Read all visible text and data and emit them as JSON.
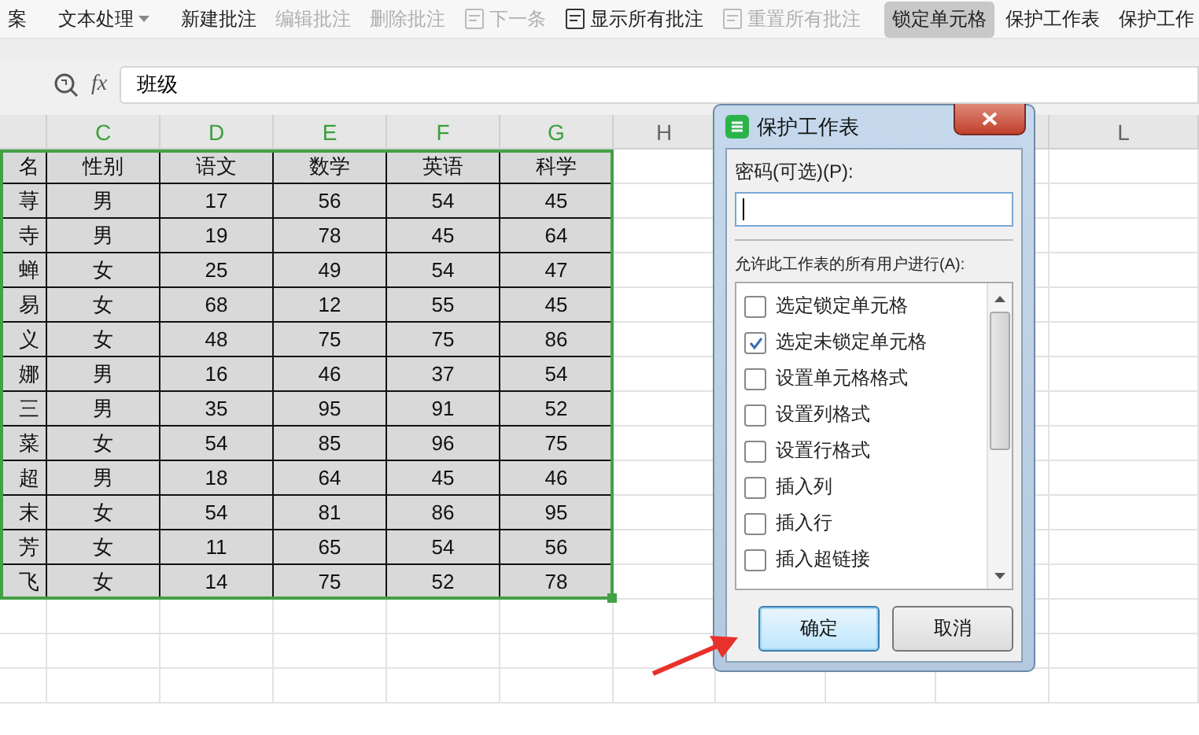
{
  "ribbon": {
    "items": [
      {
        "label": "案",
        "kind": "plain",
        "disabled": false,
        "selected": false
      },
      {
        "label": "文本处理",
        "kind": "dropdown",
        "disabled": false,
        "selected": false
      },
      {
        "label": "新建批注",
        "kind": "plain",
        "disabled": false,
        "selected": false
      },
      {
        "label": "编辑批注",
        "kind": "plain",
        "disabled": true,
        "selected": false
      },
      {
        "label": "删除批注",
        "kind": "plain",
        "disabled": true,
        "selected": false
      },
      {
        "label": "下一条",
        "kind": "icon",
        "disabled": true,
        "selected": false
      },
      {
        "label": "显示所有批注",
        "kind": "icon",
        "disabled": false,
        "selected": false
      },
      {
        "label": "重置所有批注",
        "kind": "icon",
        "disabled": true,
        "selected": false
      },
      {
        "label": "锁定单元格",
        "kind": "plain",
        "disabled": false,
        "selected": true
      },
      {
        "label": "保护工作表",
        "kind": "plain",
        "disabled": false,
        "selected": false
      },
      {
        "label": "保护工作",
        "kind": "plain",
        "disabled": false,
        "selected": false
      }
    ]
  },
  "formula_bar": {
    "fx": "fx",
    "value": "班级"
  },
  "sheet": {
    "column_headers": [
      "C",
      "D",
      "E",
      "F",
      "G",
      "H"
    ],
    "right_column_headers": [
      "L"
    ],
    "rows": [
      [
        "名",
        "性别",
        "语文",
        "数学",
        "英语",
        "科学"
      ],
      [
        "荨",
        "男",
        "17",
        "56",
        "54",
        "45"
      ],
      [
        "寺",
        "男",
        "19",
        "78",
        "45",
        "64"
      ],
      [
        "蝉",
        "女",
        "25",
        "49",
        "54",
        "47"
      ],
      [
        "易",
        "女",
        "68",
        "12",
        "55",
        "45"
      ],
      [
        "义",
        "女",
        "48",
        "75",
        "75",
        "86"
      ],
      [
        "娜",
        "男",
        "16",
        "46",
        "37",
        "54"
      ],
      [
        "三",
        "男",
        "35",
        "95",
        "91",
        "52"
      ],
      [
        "菜",
        "女",
        "54",
        "85",
        "96",
        "75"
      ],
      [
        "超",
        "男",
        "18",
        "64",
        "45",
        "46"
      ],
      [
        "末",
        "女",
        "54",
        "81",
        "86",
        "95"
      ],
      [
        "芳",
        "女",
        "11",
        "65",
        "54",
        "56"
      ],
      [
        "飞",
        "女",
        "14",
        "75",
        "52",
        "78"
      ]
    ]
  },
  "dialog": {
    "title": "保护工作表",
    "password_label": "密码(可选)(P):",
    "password_focused": true,
    "permissions_label": "允许此工作表的所有用户进行(A):",
    "permissions": [
      {
        "label": "选定锁定单元格",
        "checked": false
      },
      {
        "label": "选定未锁定单元格",
        "checked": true
      },
      {
        "label": "设置单元格格式",
        "checked": false
      },
      {
        "label": "设置列格式",
        "checked": false
      },
      {
        "label": "设置行格式",
        "checked": false
      },
      {
        "label": "插入列",
        "checked": false
      },
      {
        "label": "插入行",
        "checked": false
      },
      {
        "label": "插入超链接",
        "checked": false
      }
    ],
    "buttons": [
      {
        "label": "确定",
        "default": true
      },
      {
        "label": "取消",
        "default": false
      }
    ]
  }
}
